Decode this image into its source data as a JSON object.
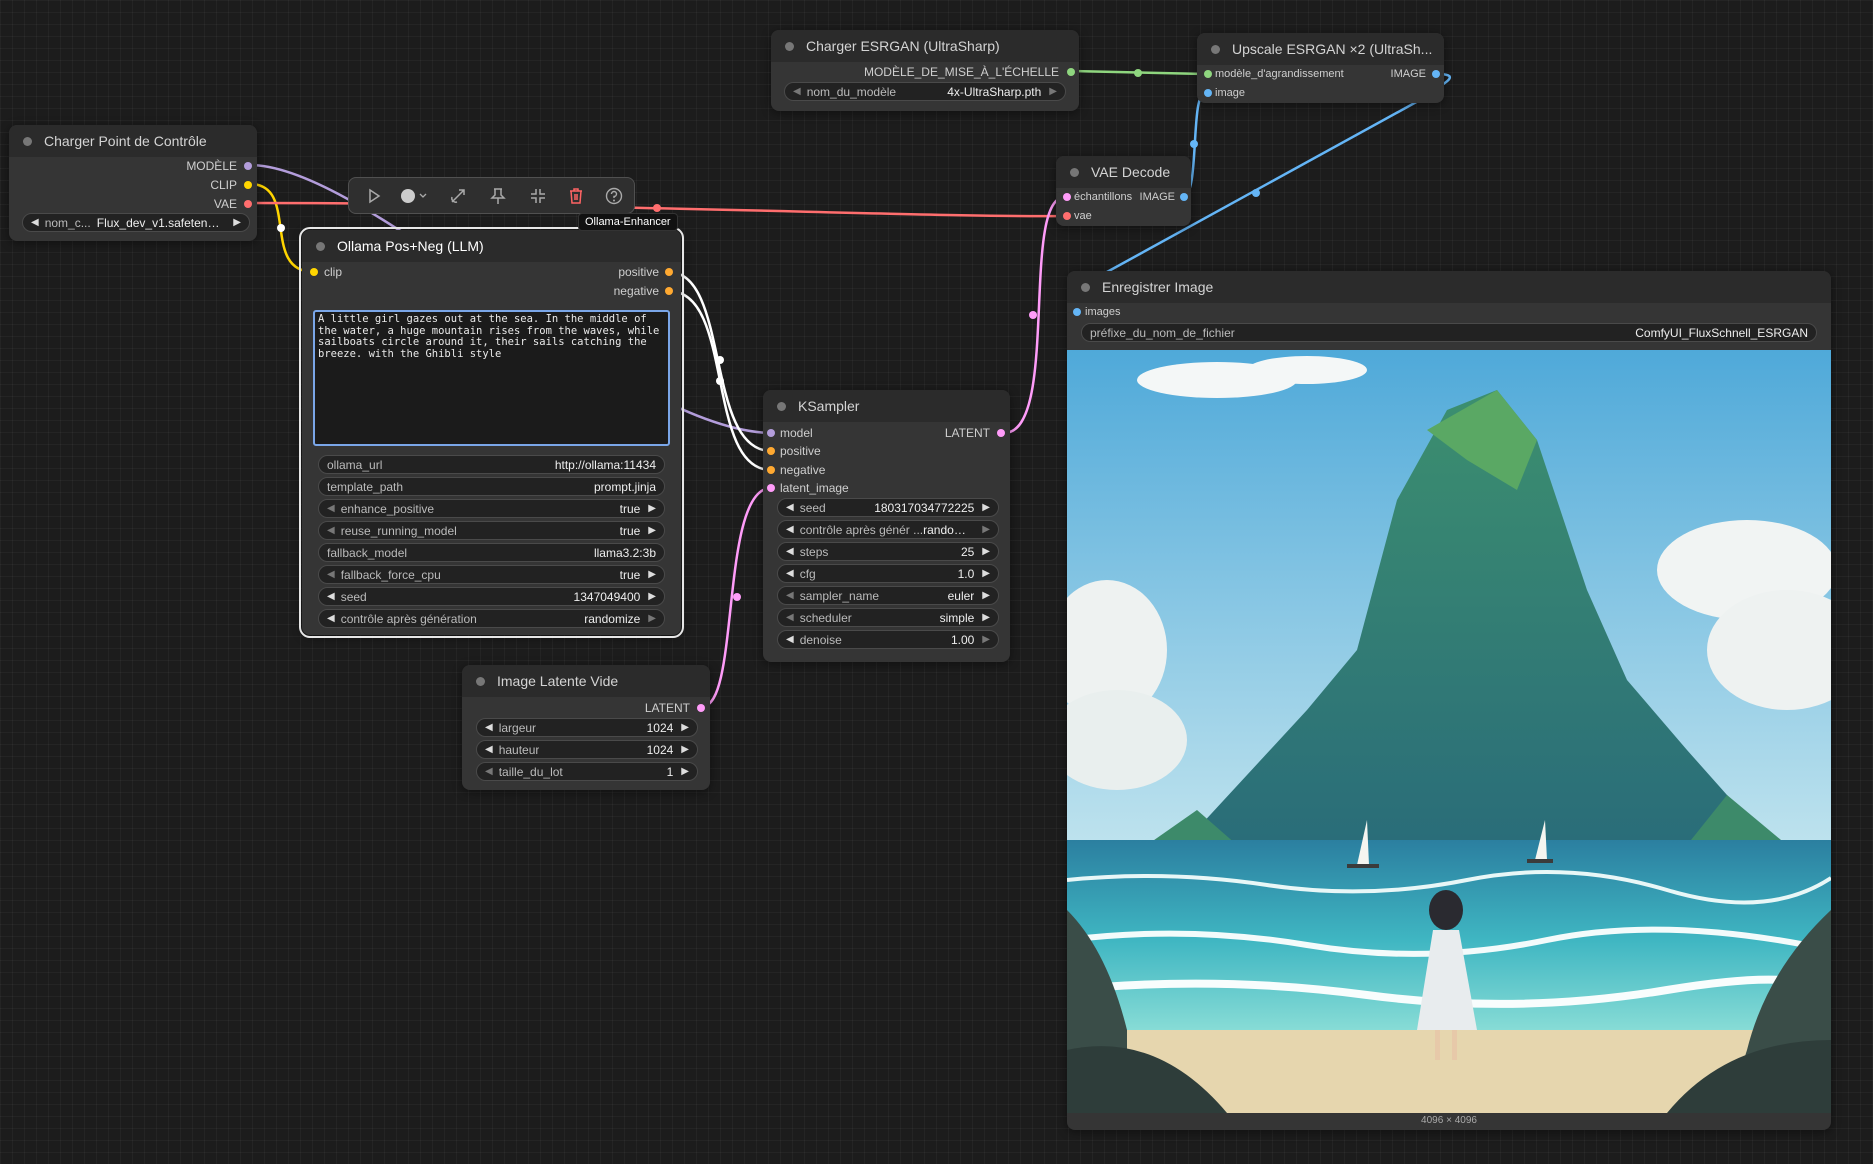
{
  "toolbar": {
    "buttons": [
      "run-icon",
      "color-circle-icon",
      "bypass-icon",
      "pin-icon",
      "collapse-icon",
      "delete-icon",
      "help-icon"
    ],
    "badge": "Ollama-Enhancer"
  },
  "checkpoint": {
    "title": "Charger Point de Contrôle",
    "outputs": [
      "MODÈLE",
      "CLIP",
      "VAE"
    ],
    "ckpt_label": "nom_c...",
    "ckpt_value": "Flux_dev_v1.safetensors"
  },
  "ollama": {
    "title": "Ollama Pos+Neg (LLM)",
    "input": "clip",
    "outputs": [
      "positive",
      "negative"
    ],
    "prompt": "A little girl gazes out at the sea. In the middle of the water, a huge mountain rises from the waves, while sailboats circle around it, their sails catching the breeze. with the Ghibli style",
    "widgets": [
      {
        "label": "ollama_url",
        "value": "http://ollama:11434"
      },
      {
        "label": "template_path",
        "value": "prompt.jinja"
      },
      {
        "label": "enhance_positive",
        "value": "true"
      },
      {
        "label": "reuse_running_model",
        "value": "true"
      },
      {
        "label": "fallback_model",
        "value": "llama3.2:3b"
      },
      {
        "label": "fallback_force_cpu",
        "value": "true"
      },
      {
        "label": "seed",
        "value": "1347049400"
      },
      {
        "label": "contrôle après génération",
        "value": "randomize"
      }
    ]
  },
  "latent": {
    "title": "Image Latente Vide",
    "output": "LATENT",
    "widgets": [
      {
        "label": "largeur",
        "value": "1024"
      },
      {
        "label": "hauteur",
        "value": "1024"
      },
      {
        "label": "taille_du_lot",
        "value": "1"
      }
    ]
  },
  "ksampler": {
    "title": "KSampler",
    "inputs": [
      "model",
      "positive",
      "negative",
      "latent_image"
    ],
    "output": "LATENT",
    "widgets": [
      {
        "label": "seed",
        "value": "180317034772225"
      },
      {
        "label": "contrôle après génér ...",
        "value": "randomize"
      },
      {
        "label": "steps",
        "value": "25"
      },
      {
        "label": "cfg",
        "value": "1.0"
      },
      {
        "label": "sampler_name",
        "value": "euler"
      },
      {
        "label": "scheduler",
        "value": "simple"
      },
      {
        "label": "denoise",
        "value": "1.00"
      }
    ]
  },
  "esrgan_loader": {
    "title": "Charger ESRGAN (UltraSharp)",
    "output": "MODÈLE_DE_MISE_À_L'ÉCHELLE",
    "widget_label": "nom_du_modèle",
    "widget_value": "4x-UltraSharp.pth"
  },
  "upscale": {
    "title": "Upscale ESRGAN ×2 (UltraSh...",
    "inputs": [
      "modèle_d'agrandissement",
      "image"
    ],
    "output": "IMAGE"
  },
  "vae_decode": {
    "title": "VAE Decode",
    "inputs": [
      "échantillons",
      "vae"
    ],
    "output": "IMAGE"
  },
  "save": {
    "title": "Enregistrer Image",
    "input": "images",
    "widget_label": "préfixe_du_nom_de_fichier",
    "widget_value": "ComfyUI_FluxSchnell_ESRGAN",
    "caption": "4096 × 4096"
  },
  "colors": {
    "model": "#b39ddb",
    "clip": "#ffd500",
    "vae": "#ff6e6e",
    "conditioning": "#ffa931",
    "latent": "#ff9cf9",
    "image": "#64b5f6",
    "upscale_model": "#8fd67f",
    "selected_outline": "#e6e6e6",
    "text_focus": "#7aa6e8"
  }
}
